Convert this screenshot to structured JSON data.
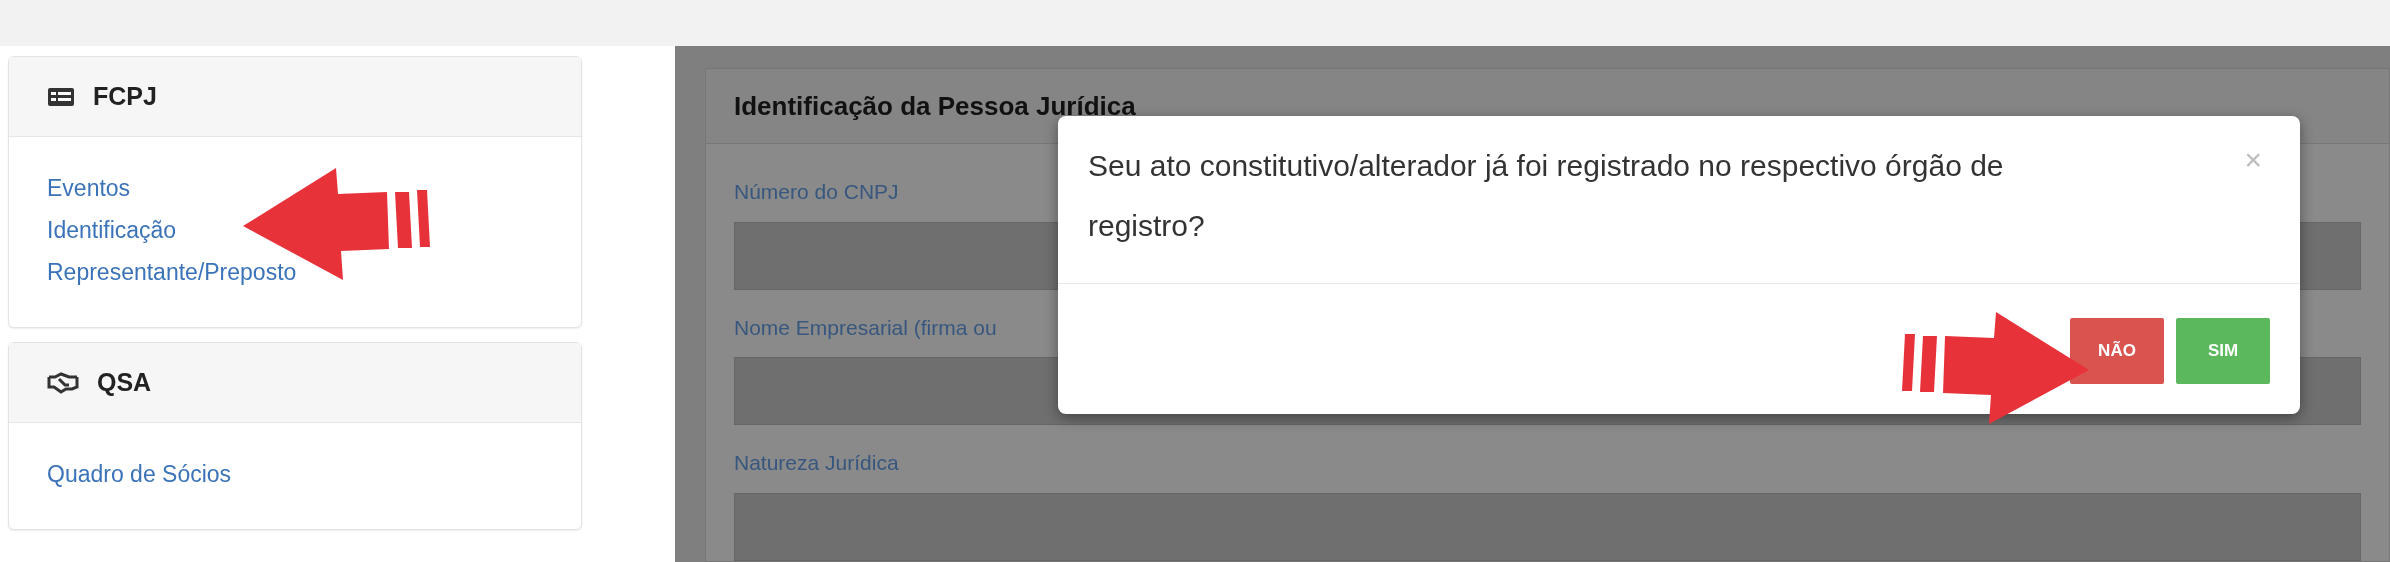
{
  "sidebar": [
    {
      "title": "FCPJ",
      "links": [
        "Eventos",
        "Identificação",
        "Representante/Preposto"
      ]
    },
    {
      "title": "QSA",
      "links": [
        "Quadro de Sócios"
      ]
    }
  ],
  "form": {
    "title": "Identificação da Pessoa Jurídica",
    "fields": [
      {
        "label": "Número do CNPJ"
      },
      {
        "label": "Nome Empresarial (firma ou"
      },
      {
        "label": "Natureza Jurídica"
      }
    ]
  },
  "modal": {
    "message": "Seu ato constitutivo/alterador já foi registrado no respectivo órgão de registro?",
    "close": "×",
    "buttons": [
      {
        "label": "NÃO",
        "kind": "danger"
      },
      {
        "label": "SIM",
        "kind": "success"
      }
    ]
  }
}
